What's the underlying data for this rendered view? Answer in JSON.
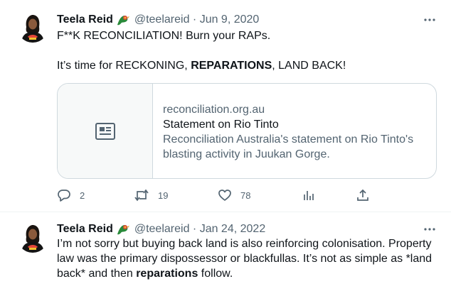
{
  "tweets": [
    {
      "author": {
        "name": "Teela Reid",
        "handle": "@teelareid",
        "date": "Jun 9, 2020"
      },
      "lines": {
        "l1": "F**K RECONCILIATION! Burn your RAPs.",
        "l2a": "It’s time for RECKONING, ",
        "l2b": "REPARATIONS",
        "l2c": ", LAND BACK!"
      },
      "card": {
        "icon": "article-icon",
        "domain": "reconciliation.org.au",
        "title": "Statement on Rio Tinto",
        "description": "Reconciliation Australia's statement on Rio Tinto's blasting activity in Juukan Gorge."
      },
      "actions": {
        "replies": "2",
        "retweets": "19",
        "likes": "78"
      }
    },
    {
      "author": {
        "name": "Teela Reid",
        "handle": "@teelareid",
        "date": "Jan 24, 2022"
      },
      "lines": {
        "l1": "I’m not sorry but buying back land is also reinforcing colonisation. Property",
        "l2": "law was the primary dispossessor or blackfullas. It’s not as simple as *land",
        "l3a": "back* and then ",
        "l3b": "reparations",
        "l3c": " follow."
      }
    }
  ],
  "meta_separator": " · ",
  "colors": {
    "text": "#0f1419",
    "secondary": "#536471",
    "border": "#cfd9de",
    "divider": "#eff3f4"
  }
}
